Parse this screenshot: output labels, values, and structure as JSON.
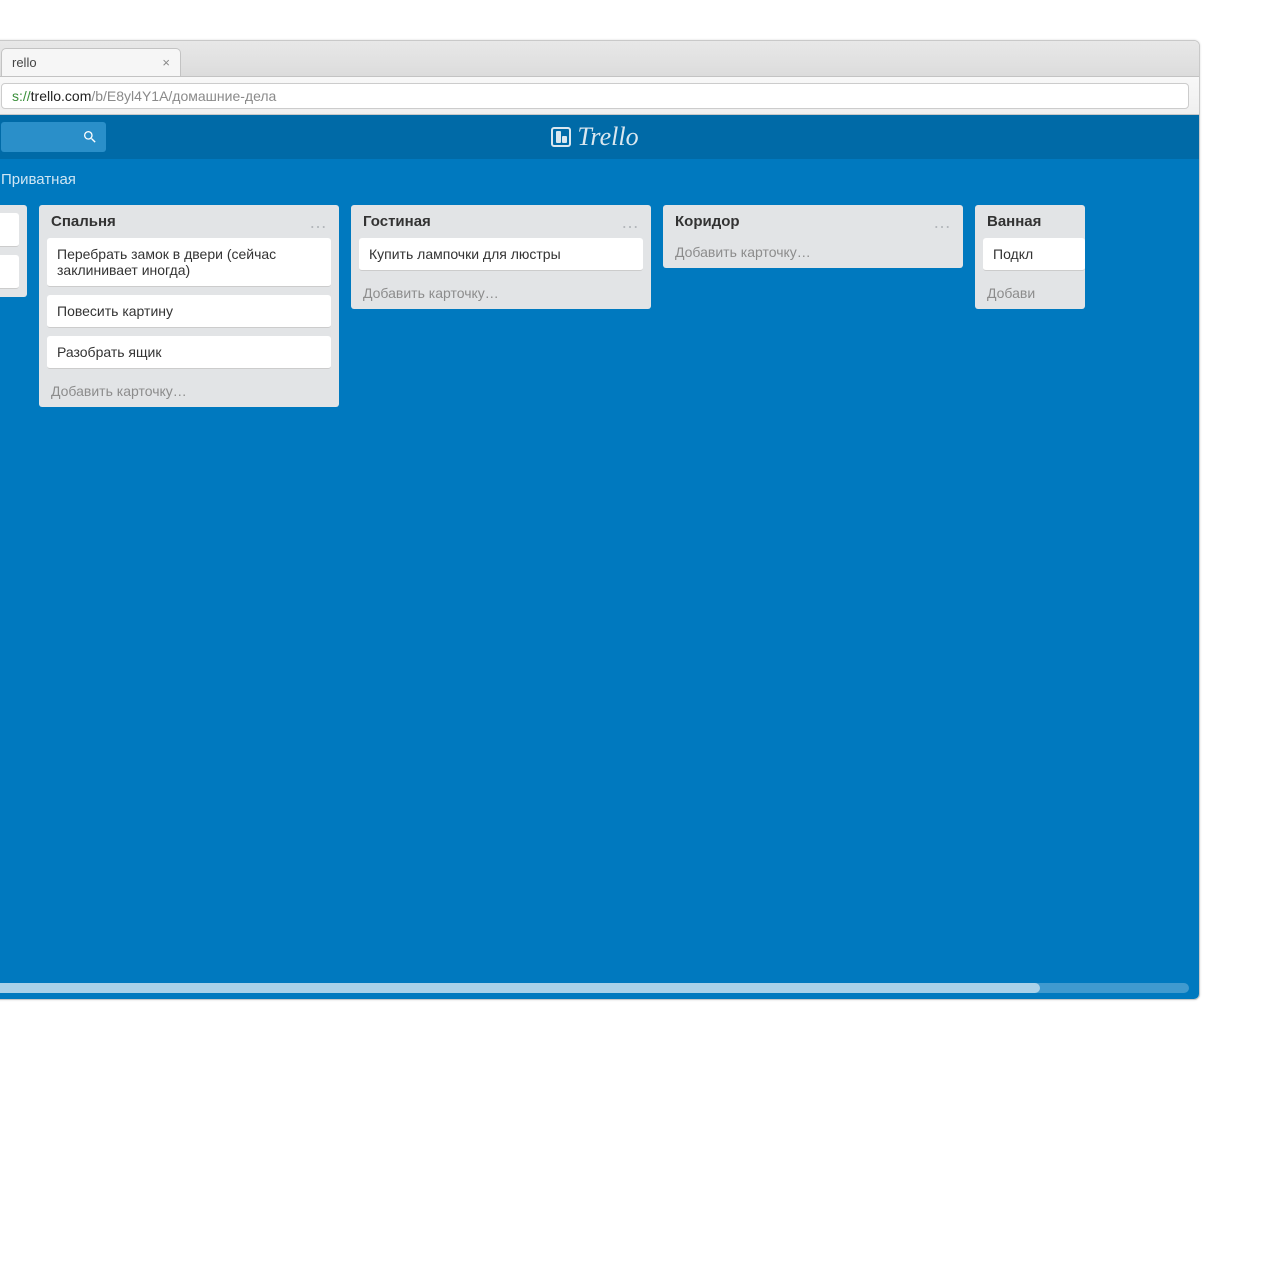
{
  "browser": {
    "tab_title": "rello",
    "url_scheme": "s://",
    "url_host": "trello.com",
    "url_path": "/b/E8yl4Y1A/домашние-дела"
  },
  "header": {
    "logo_text": "Trello"
  },
  "board_bar": {
    "privacy": "Приватная"
  },
  "lists": [
    {
      "title": "",
      "cards": [
        "",
        ""
      ],
      "add_label": ""
    },
    {
      "title": "Спальня",
      "cards": [
        "Перебрать замок в двери (сейчас заклинивает иногда)",
        "Повесить картину",
        "Разобрать ящик"
      ],
      "add_label": "Добавить карточку…"
    },
    {
      "title": "Гостиная",
      "cards": [
        "Купить лампочки для люстры"
      ],
      "add_label": "Добавить карточку…"
    },
    {
      "title": "Коридор",
      "cards": [],
      "add_label": "Добавить карточку…"
    },
    {
      "title": "Ванная",
      "cards": [
        "Подкл"
      ],
      "add_label": "Добави"
    }
  ]
}
